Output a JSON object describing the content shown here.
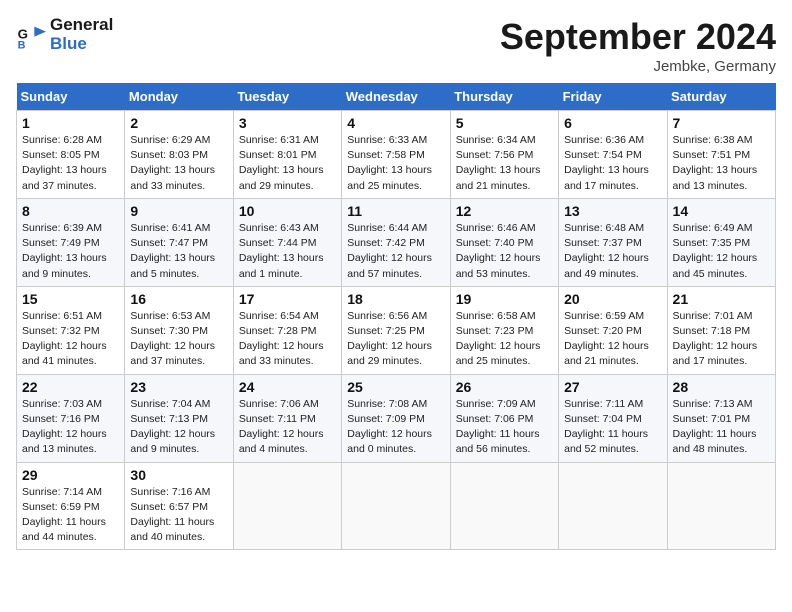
{
  "header": {
    "logo_line1": "General",
    "logo_line2": "Blue",
    "title": "September 2024",
    "subtitle": "Jembke, Germany"
  },
  "weekdays": [
    "Sunday",
    "Monday",
    "Tuesday",
    "Wednesday",
    "Thursday",
    "Friday",
    "Saturday"
  ],
  "weeks": [
    [
      {
        "day": "1",
        "sunrise": "6:28 AM",
        "sunset": "8:05 PM",
        "daylight": "13 hours and 37 minutes."
      },
      {
        "day": "2",
        "sunrise": "6:29 AM",
        "sunset": "8:03 PM",
        "daylight": "13 hours and 33 minutes."
      },
      {
        "day": "3",
        "sunrise": "6:31 AM",
        "sunset": "8:01 PM",
        "daylight": "13 hours and 29 minutes."
      },
      {
        "day": "4",
        "sunrise": "6:33 AM",
        "sunset": "7:58 PM",
        "daylight": "13 hours and 25 minutes."
      },
      {
        "day": "5",
        "sunrise": "6:34 AM",
        "sunset": "7:56 PM",
        "daylight": "13 hours and 21 minutes."
      },
      {
        "day": "6",
        "sunrise": "6:36 AM",
        "sunset": "7:54 PM",
        "daylight": "13 hours and 17 minutes."
      },
      {
        "day": "7",
        "sunrise": "6:38 AM",
        "sunset": "7:51 PM",
        "daylight": "13 hours and 13 minutes."
      }
    ],
    [
      {
        "day": "8",
        "sunrise": "6:39 AM",
        "sunset": "7:49 PM",
        "daylight": "13 hours and 9 minutes."
      },
      {
        "day": "9",
        "sunrise": "6:41 AM",
        "sunset": "7:47 PM",
        "daylight": "13 hours and 5 minutes."
      },
      {
        "day": "10",
        "sunrise": "6:43 AM",
        "sunset": "7:44 PM",
        "daylight": "13 hours and 1 minute."
      },
      {
        "day": "11",
        "sunrise": "6:44 AM",
        "sunset": "7:42 PM",
        "daylight": "12 hours and 57 minutes."
      },
      {
        "day": "12",
        "sunrise": "6:46 AM",
        "sunset": "7:40 PM",
        "daylight": "12 hours and 53 minutes."
      },
      {
        "day": "13",
        "sunrise": "6:48 AM",
        "sunset": "7:37 PM",
        "daylight": "12 hours and 49 minutes."
      },
      {
        "day": "14",
        "sunrise": "6:49 AM",
        "sunset": "7:35 PM",
        "daylight": "12 hours and 45 minutes."
      }
    ],
    [
      {
        "day": "15",
        "sunrise": "6:51 AM",
        "sunset": "7:32 PM",
        "daylight": "12 hours and 41 minutes."
      },
      {
        "day": "16",
        "sunrise": "6:53 AM",
        "sunset": "7:30 PM",
        "daylight": "12 hours and 37 minutes."
      },
      {
        "day": "17",
        "sunrise": "6:54 AM",
        "sunset": "7:28 PM",
        "daylight": "12 hours and 33 minutes."
      },
      {
        "day": "18",
        "sunrise": "6:56 AM",
        "sunset": "7:25 PM",
        "daylight": "12 hours and 29 minutes."
      },
      {
        "day": "19",
        "sunrise": "6:58 AM",
        "sunset": "7:23 PM",
        "daylight": "12 hours and 25 minutes."
      },
      {
        "day": "20",
        "sunrise": "6:59 AM",
        "sunset": "7:20 PM",
        "daylight": "12 hours and 21 minutes."
      },
      {
        "day": "21",
        "sunrise": "7:01 AM",
        "sunset": "7:18 PM",
        "daylight": "12 hours and 17 minutes."
      }
    ],
    [
      {
        "day": "22",
        "sunrise": "7:03 AM",
        "sunset": "7:16 PM",
        "daylight": "12 hours and 13 minutes."
      },
      {
        "day": "23",
        "sunrise": "7:04 AM",
        "sunset": "7:13 PM",
        "daylight": "12 hours and 9 minutes."
      },
      {
        "day": "24",
        "sunrise": "7:06 AM",
        "sunset": "7:11 PM",
        "daylight": "12 hours and 4 minutes."
      },
      {
        "day": "25",
        "sunrise": "7:08 AM",
        "sunset": "7:09 PM",
        "daylight": "12 hours and 0 minutes."
      },
      {
        "day": "26",
        "sunrise": "7:09 AM",
        "sunset": "7:06 PM",
        "daylight": "11 hours and 56 minutes."
      },
      {
        "day": "27",
        "sunrise": "7:11 AM",
        "sunset": "7:04 PM",
        "daylight": "11 hours and 52 minutes."
      },
      {
        "day": "28",
        "sunrise": "7:13 AM",
        "sunset": "7:01 PM",
        "daylight": "11 hours and 48 minutes."
      }
    ],
    [
      {
        "day": "29",
        "sunrise": "7:14 AM",
        "sunset": "6:59 PM",
        "daylight": "11 hours and 44 minutes."
      },
      {
        "day": "30",
        "sunrise": "7:16 AM",
        "sunset": "6:57 PM",
        "daylight": "11 hours and 40 minutes."
      },
      null,
      null,
      null,
      null,
      null
    ]
  ]
}
